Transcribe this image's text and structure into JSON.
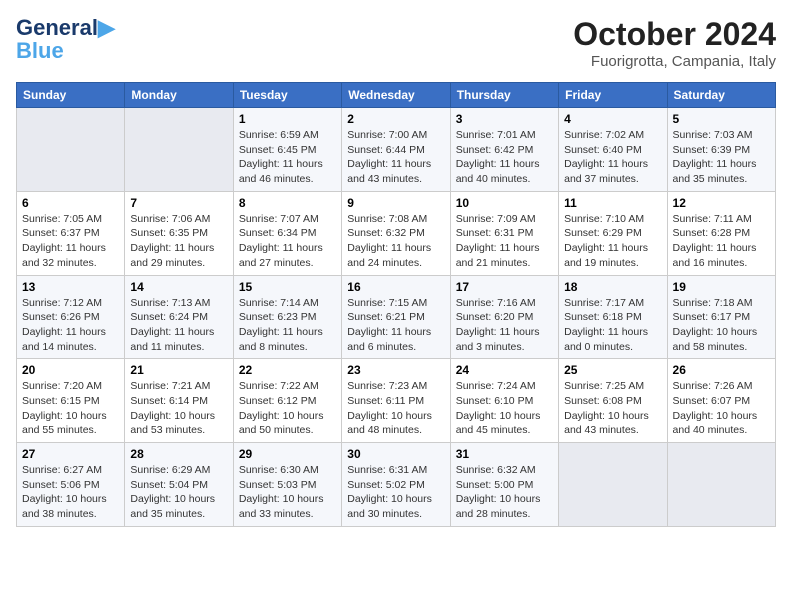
{
  "header": {
    "logo": {
      "line1": "General",
      "line2": "Blue"
    },
    "month": "October 2024",
    "location": "Fuorigrotta, Campania, Italy"
  },
  "days_of_week": [
    "Sunday",
    "Monday",
    "Tuesday",
    "Wednesday",
    "Thursday",
    "Friday",
    "Saturday"
  ],
  "weeks": [
    [
      {
        "day": "",
        "sunrise": "",
        "sunset": "",
        "daylight": ""
      },
      {
        "day": "",
        "sunrise": "",
        "sunset": "",
        "daylight": ""
      },
      {
        "day": "1",
        "sunrise": "Sunrise: 6:59 AM",
        "sunset": "Sunset: 6:45 PM",
        "daylight": "Daylight: 11 hours and 46 minutes."
      },
      {
        "day": "2",
        "sunrise": "Sunrise: 7:00 AM",
        "sunset": "Sunset: 6:44 PM",
        "daylight": "Daylight: 11 hours and 43 minutes."
      },
      {
        "day": "3",
        "sunrise": "Sunrise: 7:01 AM",
        "sunset": "Sunset: 6:42 PM",
        "daylight": "Daylight: 11 hours and 40 minutes."
      },
      {
        "day": "4",
        "sunrise": "Sunrise: 7:02 AM",
        "sunset": "Sunset: 6:40 PM",
        "daylight": "Daylight: 11 hours and 37 minutes."
      },
      {
        "day": "5",
        "sunrise": "Sunrise: 7:03 AM",
        "sunset": "Sunset: 6:39 PM",
        "daylight": "Daylight: 11 hours and 35 minutes."
      }
    ],
    [
      {
        "day": "6",
        "sunrise": "Sunrise: 7:05 AM",
        "sunset": "Sunset: 6:37 PM",
        "daylight": "Daylight: 11 hours and 32 minutes."
      },
      {
        "day": "7",
        "sunrise": "Sunrise: 7:06 AM",
        "sunset": "Sunset: 6:35 PM",
        "daylight": "Daylight: 11 hours and 29 minutes."
      },
      {
        "day": "8",
        "sunrise": "Sunrise: 7:07 AM",
        "sunset": "Sunset: 6:34 PM",
        "daylight": "Daylight: 11 hours and 27 minutes."
      },
      {
        "day": "9",
        "sunrise": "Sunrise: 7:08 AM",
        "sunset": "Sunset: 6:32 PM",
        "daylight": "Daylight: 11 hours and 24 minutes."
      },
      {
        "day": "10",
        "sunrise": "Sunrise: 7:09 AM",
        "sunset": "Sunset: 6:31 PM",
        "daylight": "Daylight: 11 hours and 21 minutes."
      },
      {
        "day": "11",
        "sunrise": "Sunrise: 7:10 AM",
        "sunset": "Sunset: 6:29 PM",
        "daylight": "Daylight: 11 hours and 19 minutes."
      },
      {
        "day": "12",
        "sunrise": "Sunrise: 7:11 AM",
        "sunset": "Sunset: 6:28 PM",
        "daylight": "Daylight: 11 hours and 16 minutes."
      }
    ],
    [
      {
        "day": "13",
        "sunrise": "Sunrise: 7:12 AM",
        "sunset": "Sunset: 6:26 PM",
        "daylight": "Daylight: 11 hours and 14 minutes."
      },
      {
        "day": "14",
        "sunrise": "Sunrise: 7:13 AM",
        "sunset": "Sunset: 6:24 PM",
        "daylight": "Daylight: 11 hours and 11 minutes."
      },
      {
        "day": "15",
        "sunrise": "Sunrise: 7:14 AM",
        "sunset": "Sunset: 6:23 PM",
        "daylight": "Daylight: 11 hours and 8 minutes."
      },
      {
        "day": "16",
        "sunrise": "Sunrise: 7:15 AM",
        "sunset": "Sunset: 6:21 PM",
        "daylight": "Daylight: 11 hours and 6 minutes."
      },
      {
        "day": "17",
        "sunrise": "Sunrise: 7:16 AM",
        "sunset": "Sunset: 6:20 PM",
        "daylight": "Daylight: 11 hours and 3 minutes."
      },
      {
        "day": "18",
        "sunrise": "Sunrise: 7:17 AM",
        "sunset": "Sunset: 6:18 PM",
        "daylight": "Daylight: 11 hours and 0 minutes."
      },
      {
        "day": "19",
        "sunrise": "Sunrise: 7:18 AM",
        "sunset": "Sunset: 6:17 PM",
        "daylight": "Daylight: 10 hours and 58 minutes."
      }
    ],
    [
      {
        "day": "20",
        "sunrise": "Sunrise: 7:20 AM",
        "sunset": "Sunset: 6:15 PM",
        "daylight": "Daylight: 10 hours and 55 minutes."
      },
      {
        "day": "21",
        "sunrise": "Sunrise: 7:21 AM",
        "sunset": "Sunset: 6:14 PM",
        "daylight": "Daylight: 10 hours and 53 minutes."
      },
      {
        "day": "22",
        "sunrise": "Sunrise: 7:22 AM",
        "sunset": "Sunset: 6:12 PM",
        "daylight": "Daylight: 10 hours and 50 minutes."
      },
      {
        "day": "23",
        "sunrise": "Sunrise: 7:23 AM",
        "sunset": "Sunset: 6:11 PM",
        "daylight": "Daylight: 10 hours and 48 minutes."
      },
      {
        "day": "24",
        "sunrise": "Sunrise: 7:24 AM",
        "sunset": "Sunset: 6:10 PM",
        "daylight": "Daylight: 10 hours and 45 minutes."
      },
      {
        "day": "25",
        "sunrise": "Sunrise: 7:25 AM",
        "sunset": "Sunset: 6:08 PM",
        "daylight": "Daylight: 10 hours and 43 minutes."
      },
      {
        "day": "26",
        "sunrise": "Sunrise: 7:26 AM",
        "sunset": "Sunset: 6:07 PM",
        "daylight": "Daylight: 10 hours and 40 minutes."
      }
    ],
    [
      {
        "day": "27",
        "sunrise": "Sunrise: 6:27 AM",
        "sunset": "Sunset: 5:06 PM",
        "daylight": "Daylight: 10 hours and 38 minutes."
      },
      {
        "day": "28",
        "sunrise": "Sunrise: 6:29 AM",
        "sunset": "Sunset: 5:04 PM",
        "daylight": "Daylight: 10 hours and 35 minutes."
      },
      {
        "day": "29",
        "sunrise": "Sunrise: 6:30 AM",
        "sunset": "Sunset: 5:03 PM",
        "daylight": "Daylight: 10 hours and 33 minutes."
      },
      {
        "day": "30",
        "sunrise": "Sunrise: 6:31 AM",
        "sunset": "Sunset: 5:02 PM",
        "daylight": "Daylight: 10 hours and 30 minutes."
      },
      {
        "day": "31",
        "sunrise": "Sunrise: 6:32 AM",
        "sunset": "Sunset: 5:00 PM",
        "daylight": "Daylight: 10 hours and 28 minutes."
      },
      {
        "day": "",
        "sunrise": "",
        "sunset": "",
        "daylight": ""
      },
      {
        "day": "",
        "sunrise": "",
        "sunset": "",
        "daylight": ""
      }
    ]
  ]
}
